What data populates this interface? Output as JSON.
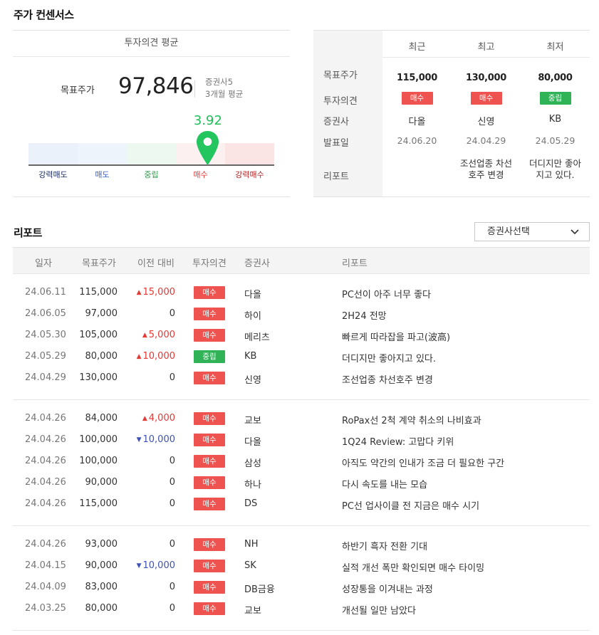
{
  "consensus": {
    "title": "주가 컨센서스",
    "avg_header": "투자의견 평균",
    "target_label": "목표주가",
    "target_value": "97,846",
    "brokers_count": "증권사5",
    "period": "3개월 평균",
    "score": "3.92",
    "score_fraction": 0.73,
    "gauge": [
      {
        "label": "강력매도",
        "bg": "#eaf1fa",
        "color": "#1a2b66"
      },
      {
        "label": "매도",
        "bg": "#eef4fb",
        "color": "#3b5fc0"
      },
      {
        "label": "중립",
        "bg": "#edf8f0",
        "color": "#2e9a4e"
      },
      {
        "label": "매수",
        "bg": "#fdf0f0",
        "color": "#e53935"
      },
      {
        "label": "강력매수",
        "bg": "#fbe4e4",
        "color": "#b71c1c"
      }
    ],
    "pin_color": "#22c55e",
    "columns": [
      "최근",
      "최고",
      "최저"
    ],
    "row_labels": {
      "target": "목표주가",
      "opinion": "투자의견",
      "broker": "증권사",
      "date": "발표일",
      "report": "리포트"
    },
    "cells": [
      {
        "target": "115,000",
        "opinion": "매수",
        "opinion_type": "buy",
        "broker": "다올",
        "date": "24.06.20",
        "report": ""
      },
      {
        "target": "130,000",
        "opinion": "매수",
        "opinion_type": "buy",
        "broker": "신영",
        "date": "24.04.29",
        "report_l1": "조선업종 차선",
        "report_l2": "호주 변경"
      },
      {
        "target": "80,000",
        "opinion": "중립",
        "opinion_type": "hold",
        "broker": "KB",
        "date": "24.05.29",
        "report_l1": "더디지만 좋아",
        "report_l2": "지고 있다."
      }
    ]
  },
  "reports": {
    "title": "리포트",
    "broker_select": "증권사선택",
    "headers": {
      "date": "일자",
      "target": "목표주가",
      "change": "이전 대비",
      "opinion": "투자의견",
      "broker": "증권사",
      "report": "리포트"
    },
    "colors": {
      "buy": "#ef5350",
      "hold": "#2fb356",
      "up": "#e53935",
      "down": "#3f51b5"
    },
    "rows": [
      {
        "date": "24.06.11",
        "target": "115,000",
        "change": "15,000",
        "dir": "up",
        "opinion": "매수",
        "type": "buy",
        "broker": "다올",
        "title": "PC선이 아주 너무 좋다"
      },
      {
        "date": "24.06.05",
        "target": "97,000",
        "change": "0",
        "dir": "flat",
        "opinion": "매수",
        "type": "buy",
        "broker": "하이",
        "title": "2H24 전망"
      },
      {
        "date": "24.05.30",
        "target": "105,000",
        "change": "5,000",
        "dir": "up",
        "opinion": "매수",
        "type": "buy",
        "broker": "메리츠",
        "title": "빠르게 따라잡을 파고(波高)"
      },
      {
        "date": "24.05.29",
        "target": "80,000",
        "change": "10,000",
        "dir": "up",
        "opinion": "중립",
        "type": "hold",
        "broker": "KB",
        "title": "더디지만 좋아지고 있다."
      },
      {
        "date": "24.04.29",
        "target": "130,000",
        "change": "0",
        "dir": "flat",
        "opinion": "매수",
        "type": "buy",
        "broker": "신영",
        "title": "조선업종 차선호주 변경"
      },
      {
        "date": "24.04.26",
        "target": "84,000",
        "change": "4,000",
        "dir": "up",
        "opinion": "매수",
        "type": "buy",
        "broker": "교보",
        "title": "RoPax선 2척 계약 취소의 나비효과"
      },
      {
        "date": "24.04.26",
        "target": "100,000",
        "change": "10,000",
        "dir": "down",
        "opinion": "매수",
        "type": "buy",
        "broker": "다올",
        "title": "1Q24 Review: 고맙다 키위"
      },
      {
        "date": "24.04.26",
        "target": "100,000",
        "change": "0",
        "dir": "flat",
        "opinion": "매수",
        "type": "buy",
        "broker": "삼성",
        "title": "아직도 약간의 인내가 조금 더 필요한 구간"
      },
      {
        "date": "24.04.26",
        "target": "90,000",
        "change": "0",
        "dir": "flat",
        "opinion": "매수",
        "type": "buy",
        "broker": "하나",
        "title": "다시 속도를 내는 모습"
      },
      {
        "date": "24.04.26",
        "target": "115,000",
        "change": "0",
        "dir": "flat",
        "opinion": "매수",
        "type": "buy",
        "broker": "DS",
        "title": "PC선 업사이클 전 지금은 매수 시기"
      },
      {
        "date": "24.04.26",
        "target": "93,000",
        "change": "0",
        "dir": "flat",
        "opinion": "매수",
        "type": "buy",
        "broker": "NH",
        "title": "하반기 흑자 전환 기대"
      },
      {
        "date": "24.04.15",
        "target": "90,000",
        "change": "10,000",
        "dir": "down",
        "opinion": "매수",
        "type": "buy",
        "broker": "SK",
        "title": "실적 개선 폭만 확인되면 매수 타이밍"
      },
      {
        "date": "24.04.09",
        "target": "83,000",
        "change": "0",
        "dir": "flat",
        "opinion": "매수",
        "type": "buy",
        "broker": "DB금융",
        "title": "성장통을 이겨내는 과정"
      },
      {
        "date": "24.03.25",
        "target": "80,000",
        "change": "0",
        "dir": "flat",
        "opinion": "매수",
        "type": "buy",
        "broker": "교보",
        "title": "개선될 일만 남았다"
      }
    ]
  }
}
